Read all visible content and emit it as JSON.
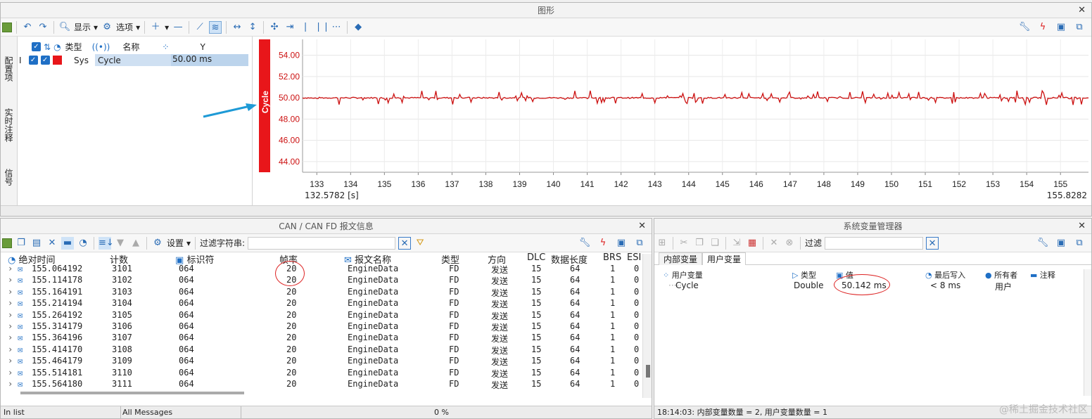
{
  "graph": {
    "title": "图形",
    "toolbar": {
      "display_label": "显示",
      "options_label": "选项"
    },
    "side_tabs": [
      "配置项",
      "实时注释",
      "信号"
    ],
    "grid_headers": {
      "type": "类型",
      "name": "名称",
      "y": "Y"
    },
    "signal": {
      "type": "Sys",
      "name": "Cycle",
      "value": "50.00 ms",
      "color": "#e8161a"
    },
    "axis_label": "Cycle",
    "y_ticks": [
      "54.00",
      "52.00",
      "50.00",
      "48.00",
      "46.00",
      "44.00"
    ],
    "x_ticks": [
      "133",
      "134",
      "135",
      "136",
      "137",
      "138",
      "139",
      "140",
      "141",
      "142",
      "143",
      "144",
      "145",
      "146",
      "147",
      "148",
      "149",
      "150",
      "151",
      "152",
      "153",
      "154",
      "155"
    ],
    "x_start": "132.5782 [s]",
    "x_end": "155.8282"
  },
  "chart_data": {
    "type": "line",
    "title": "",
    "xlabel": "",
    "ylabel": "Cycle",
    "xlim": [
      132.5782,
      155.8282
    ],
    "ylim": [
      43.0,
      55.5
    ],
    "series": [
      {
        "name": "Cycle",
        "color": "#cc1111",
        "x_start": 132.5782,
        "x_end": 155.8282,
        "baseline": 50.0,
        "jitter": 0.35
      }
    ]
  },
  "messages": {
    "title": "CAN / CAN FD 报文信息",
    "toolbar": {
      "settings_label": "设置",
      "filter_label": "过滤字符串:"
    },
    "columns": [
      "绝对时间",
      "计数",
      "标识符",
      "帧率",
      "报文名称",
      "类型",
      "方向",
      "DLC",
      "数据长度",
      "BRS",
      "ESI"
    ],
    "rows": [
      [
        "155.064192",
        "3101",
        "064",
        "20",
        "EngineData",
        "FD",
        "发送",
        "15",
        "64",
        "1",
        "0"
      ],
      [
        "155.114178",
        "3102",
        "064",
        "20",
        "EngineData",
        "FD",
        "发送",
        "15",
        "64",
        "1",
        "0"
      ],
      [
        "155.164191",
        "3103",
        "064",
        "20",
        "EngineData",
        "FD",
        "发送",
        "15",
        "64",
        "1",
        "0"
      ],
      [
        "155.214194",
        "3104",
        "064",
        "20",
        "EngineData",
        "FD",
        "发送",
        "15",
        "64",
        "1",
        "0"
      ],
      [
        "155.264192",
        "3105",
        "064",
        "20",
        "EngineData",
        "FD",
        "发送",
        "15",
        "64",
        "1",
        "0"
      ],
      [
        "155.314179",
        "3106",
        "064",
        "20",
        "EngineData",
        "FD",
        "发送",
        "15",
        "64",
        "1",
        "0"
      ],
      [
        "155.364196",
        "3107",
        "064",
        "20",
        "EngineData",
        "FD",
        "发送",
        "15",
        "64",
        "1",
        "0"
      ],
      [
        "155.414170",
        "3108",
        "064",
        "20",
        "EngineData",
        "FD",
        "发送",
        "15",
        "64",
        "1",
        "0"
      ],
      [
        "155.464179",
        "3109",
        "064",
        "20",
        "EngineData",
        "FD",
        "发送",
        "15",
        "64",
        "1",
        "0"
      ],
      [
        "155.514181",
        "3110",
        "064",
        "20",
        "EngineData",
        "FD",
        "发送",
        "15",
        "64",
        "1",
        "0"
      ],
      [
        "155.564180",
        "3111",
        "064",
        "20",
        "EngineData",
        "FD",
        "发送",
        "15",
        "64",
        "1",
        "0"
      ]
    ],
    "status": {
      "left": "In list",
      "middle": "All Messages",
      "progress": "0 %"
    }
  },
  "sysvars": {
    "title": "系统变量管理器",
    "filter_label": "过滤",
    "tabs": [
      "内部变量",
      "用户变量"
    ],
    "headers": {
      "name": "用户变量",
      "type": "类型",
      "value": "值",
      "last_write": "最后写入",
      "owner": "所有者",
      "comment": "注释"
    },
    "row": {
      "name": "Cycle",
      "type": "Double",
      "value": "50.142 ms",
      "last_write": "< 8 ms",
      "owner": "用户"
    },
    "status": "18:14:03: 内部变量数量 = 2, 用户变量数量 = 1"
  },
  "watermark": "@稀土掘金技术社区"
}
